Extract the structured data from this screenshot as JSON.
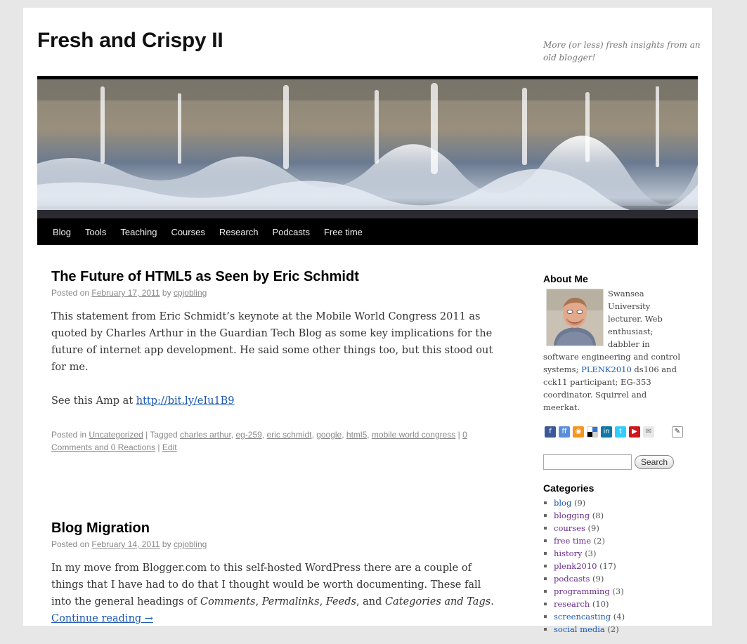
{
  "site": {
    "title": "Fresh and Crispy II",
    "description": "More (or less) fresh insights from an old blogger!"
  },
  "nav": [
    "Blog",
    "Tools",
    "Teaching",
    "Courses",
    "Research",
    "Podcasts",
    "Free time"
  ],
  "posts": [
    {
      "title": "The Future of HTML5 as Seen by Eric Schmidt",
      "posted_on": "Posted on",
      "date": "February 17, 2011",
      "by": "by",
      "author": "cpjobling",
      "para1": "This statement from Eric Schmidt’s keynote at the Mobile World Congress 2011 as quoted by Charles Arthur in the Guardian Tech Blog as some key implications for the future of internet app development. He said some other things too, but this stood out for me.",
      "para2_prefix": "See this Amp at",
      "link": "http://bit.ly/eIu1B9",
      "posted_in": "Posted in",
      "category": "Uncategorized",
      "tagged": "| Tagged",
      "tags": [
        "charles arthur",
        "eg-259",
        "eric schmidt",
        "google",
        "html5",
        "mobile world congress"
      ],
      "comments": "0 Comments and 0 Reactions",
      "edit": "Edit"
    },
    {
      "title": "Blog Migration",
      "posted_on": "Posted on",
      "date": "February 14, 2011",
      "by": "by",
      "author": "cpjobling",
      "body_start": "In my move from Blogger.com to this self-hosted WordPress there are a couple of things that I have had to do that I thought would be worth documenting. These fall into the general headings of ",
      "em1": "Comments",
      "em2": "Permalinks",
      "em3": "Feeds",
      "and": ", and ",
      "em4": "Categories and Tags",
      "continue": "Continue reading →"
    }
  ],
  "sidebar": {
    "about_title": "About Me",
    "about_text_1": "Swansea University lecturer. Web enthusiast; dabbler in software engineering and control systems; ",
    "about_link": "PLENK2010",
    "about_text_2": " ds106 and cck11 participant; EG-353 coordinator. Squirrel and meerkat.",
    "social_icons": [
      "facebook-icon",
      "friendfeed-icon",
      "rss-icon",
      "delicious-icon",
      "linkedin-icon",
      "twitter-icon",
      "youtube-icon",
      "email-icon",
      "vcard-icon"
    ],
    "search_placeholder": "",
    "search_button": "Search",
    "categories_title": "Categories",
    "categories": [
      {
        "name": "blog",
        "count": "(9)",
        "visited": false
      },
      {
        "name": "blogging",
        "count": "(8)",
        "visited": true
      },
      {
        "name": "courses",
        "count": "(9)",
        "visited": true
      },
      {
        "name": "free time",
        "count": "(2)",
        "visited": true
      },
      {
        "name": "history",
        "count": "(3)",
        "visited": true
      },
      {
        "name": "plenk2010",
        "count": "(17)",
        "visited": true
      },
      {
        "name": "podcasts",
        "count": "(9)",
        "visited": true
      },
      {
        "name": "programming",
        "count": "(3)",
        "visited": true
      },
      {
        "name": "research",
        "count": "(10)",
        "visited": true
      },
      {
        "name": "screencasting",
        "count": "(4)",
        "visited": false
      },
      {
        "name": "social media",
        "count": "(2)",
        "visited": false
      }
    ]
  },
  "colors": {
    "link": "#1b57b1",
    "visited": "#6a2e8c",
    "nav_bg": "#000000"
  }
}
